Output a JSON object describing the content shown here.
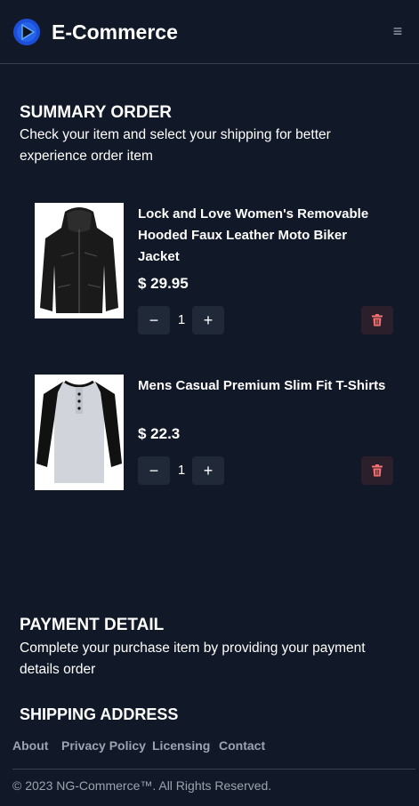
{
  "navbar": {
    "brand": "E-Commerce",
    "logo_icon": "logo-icon",
    "menu_icon": "≡",
    "accent_color": "#1d4ed8"
  },
  "summary": {
    "title": "SUMMARY ORDER",
    "description": "Check your item and select your shipping for better experience order item"
  },
  "cart": {
    "items": [
      {
        "name": "Lock and Love Women's Removable Hooded Faux Leather Moto Biker Jacket",
        "price": "$ 29.95",
        "quantity": "1",
        "image_icon": "jacket-image"
      },
      {
        "name": "Mens Casual Premium Slim Fit T-Shirts",
        "price": "$ 22.3",
        "quantity": "1",
        "image_icon": "tshirt-image"
      }
    ],
    "decrement_label": "−",
    "increment_label": "+",
    "delete_icon": "trash-icon",
    "delete_color": "#f87171"
  },
  "payment": {
    "title": "PAYMENT DETAIL",
    "description": "Complete your purchase item by providing your payment details order"
  },
  "shipping": {
    "title": "SHIPPING ADDRESS"
  },
  "footer": {
    "links": [
      "About",
      "Privacy Policy",
      "Licensing",
      "Contact"
    ],
    "copyright": "© 2023 NG-Commerce™. All Rights Reserved."
  }
}
